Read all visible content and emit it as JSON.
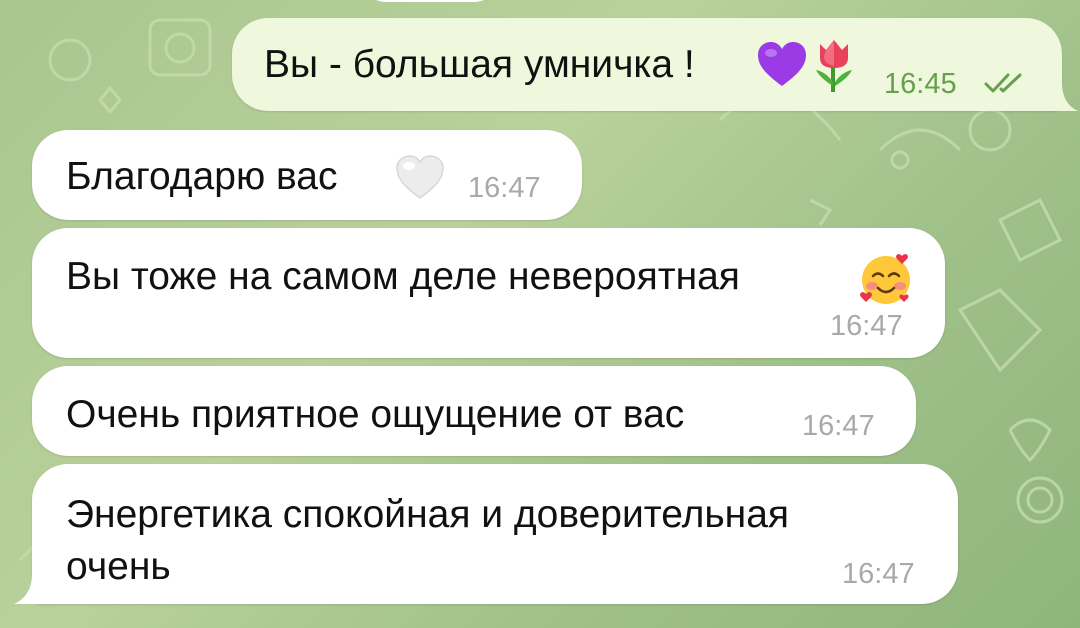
{
  "messages": [
    {
      "id": "m1",
      "direction": "outgoing",
      "text": "Вы - большая умничка !",
      "emoji": [
        "purple-heart",
        "tulip"
      ],
      "time": "16:45",
      "read": true
    },
    {
      "id": "m2",
      "direction": "incoming",
      "text": "Благодарю вас",
      "emoji": [
        "white-heart"
      ],
      "time": "16:47"
    },
    {
      "id": "m3",
      "direction": "incoming",
      "text": "Вы тоже на самом деле невероятная",
      "emoji": [
        "smiling-face-with-hearts"
      ],
      "time": "16:47"
    },
    {
      "id": "m4",
      "direction": "incoming",
      "text": "Очень приятное ощущение от вас",
      "time": "16:47"
    },
    {
      "id": "m5",
      "direction": "incoming",
      "text_lines": [
        "Энергетика спокойная и доверительная",
        "очень"
      ],
      "time": "16:47"
    }
  ],
  "colors": {
    "incoming_bubble": "#ffffff",
    "outgoing_bubble": "#eff8dc",
    "outgoing_time": "#66a04e",
    "incoming_time": "#a9a9a9",
    "background": "#a9c68f"
  }
}
